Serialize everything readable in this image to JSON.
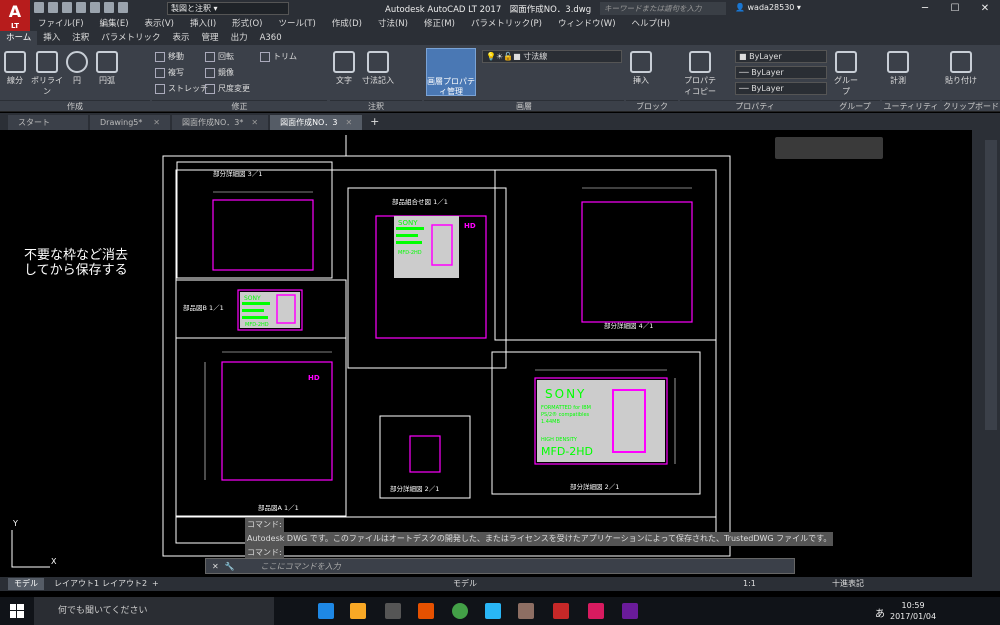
{
  "app": {
    "logo_text": "A",
    "logo_sub": "LT",
    "workspace": "製図と注釈",
    "window_title": "Autodesk AutoCAD LT 2017　図面作成NO．3.dwg",
    "search_placeholder": "キーワードまたは語句を入力",
    "user": "wada28530",
    "help": "?"
  },
  "menu": [
    "ファイル(F)",
    "編集(E)",
    "表示(V)",
    "挿入(I)",
    "形式(O)",
    "ツール(T)",
    "作成(D)",
    "寸法(N)",
    "修正(M)",
    "パラメトリック(P)",
    "ウィンドウ(W)",
    "ヘルプ(H)"
  ],
  "ribbon_tabs": [
    "ホーム",
    "挿入",
    "注釈",
    "パラメトリック",
    "表示",
    "管理",
    "出力",
    "A360"
  ],
  "ribbon": {
    "draw": {
      "line": "線分",
      "polyline": "ポリライン",
      "circle": "円",
      "arc": "円弧",
      "panel": "作成"
    },
    "modify": {
      "move": "移動",
      "rotate": "回転",
      "trim": "トリム",
      "copy": "複写",
      "mirror": "鏡像",
      "stretch": "ストレッチ",
      "scale": "尺度変更",
      "panel": "修正"
    },
    "annotation": {
      "text": "文字",
      "dimension": "寸法記入",
      "panel": "注釈"
    },
    "layers": {
      "layer_props": "画層プロパティ管理",
      "current_layer": "寸法線",
      "panel": "画層"
    },
    "block": {
      "insert": "挿入",
      "panel": "ブロック"
    },
    "properties": {
      "match": "プロパティコピー",
      "color": "ByLayer",
      "linetype": "ByLayer",
      "lineweight": "ByLayer",
      "panel": "プロパティ"
    },
    "groups": {
      "group": "グループ",
      "panel": "グループ"
    },
    "utilities": {
      "measure": "計測",
      "panel": "ユーティリティ"
    },
    "clipboard": {
      "paste": "貼り付け",
      "panel": "クリップボード"
    }
  },
  "doc_tabs": [
    {
      "label": "スタート"
    },
    {
      "label": "Drawing5*"
    },
    {
      "label": "図面作成NO．3*"
    },
    {
      "label": "図面作成NO．3"
    }
  ],
  "canvas": {
    "note_line1": "不要な枠など消去",
    "note_line2": "してから保存する",
    "labels": {
      "detail31": "部分詳細図 3／1",
      "assembly": "部品組合せ図 1／1",
      "detail41": "部分詳細図 4／1",
      "partB": "部品図B 1／1",
      "partA": "部品図A 1／1",
      "detail21a": "部分詳細図 2／1",
      "detail21b": "部分詳細図 2／1"
    },
    "sony": "SONY",
    "formatted": "FORMATTED for IBM",
    "ps2": "PS/2® compatibles",
    "cap": "1.44MB",
    "density": "HIGH DENSITY",
    "model": "MFD-2HD",
    "hd": "HD",
    "ucs_y": "Y",
    "ucs_x": "X"
  },
  "command": {
    "hist1": "コマンド:",
    "hist2": "Autodesk DWG です。このファイルはオートデスクの開発した、またはライセンスを受けたアプリケーションによって保存された、TrustedDWG ファイルです。",
    "hist3": "コマンド:",
    "placeholder": "ここにコマンドを入力"
  },
  "layout_tabs": [
    "モデル",
    "レイアウト1",
    "レイアウト2"
  ],
  "status": {
    "model": "モデル",
    "scale": "1:1",
    "style": "十進表記"
  },
  "taskbar": {
    "search": "何でも聞いてください",
    "time": "10:59",
    "date": "2017/01/04",
    "ime": "あ"
  },
  "colors": {
    "accent": "#4a78b4",
    "magenta": "#ff00ff",
    "green": "#00ff00"
  }
}
